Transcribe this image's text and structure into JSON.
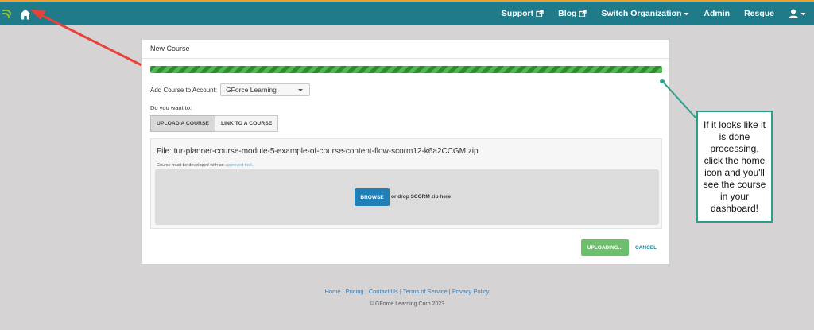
{
  "nav": {
    "support": "Support",
    "blog": "Blog",
    "switch_org": "Switch Organization",
    "admin": "Admin",
    "resque": "Resque"
  },
  "panel": {
    "title": "New Course",
    "progress": 1.0,
    "account_label": "Add Course to Account:",
    "account_value": "GForce Learning",
    "question": "Do you want to:",
    "tab_upload": "UPLOAD A COURSE",
    "tab_link": "LINK TO A COURSE",
    "file_line": "File: tur-planner-course-module-5-example-of-course-content-flow-scorm12-k6a2CCGM.zip",
    "hint_prefix": "Course must be developed with an",
    "hint_link": "approved tool",
    "hint_suffix": ".",
    "browse": "BROWSE",
    "drop_text": "or drop SCORM zip here",
    "uploading": "UPLOADING...",
    "cancel": "CANCEL"
  },
  "footer": {
    "home": "Home",
    "pricing": "Pricing",
    "contact": "Contact Us",
    "terms": "Terms of Service",
    "privacy": "Privacy Policy",
    "separator": "|",
    "copyright": "© GForce Learning Corp 2023"
  },
  "annotation": {
    "callout": "If it looks like it is done processing, click the home icon and you'll see the course in your dashboard!"
  },
  "colors": {
    "topbar": "#1f7a8a",
    "progress": "#2e8b2e",
    "browse": "#1f7fb6",
    "uploading": "#6cc06c",
    "arrow": "#e8413a",
    "callout_border": "#28a08a"
  }
}
